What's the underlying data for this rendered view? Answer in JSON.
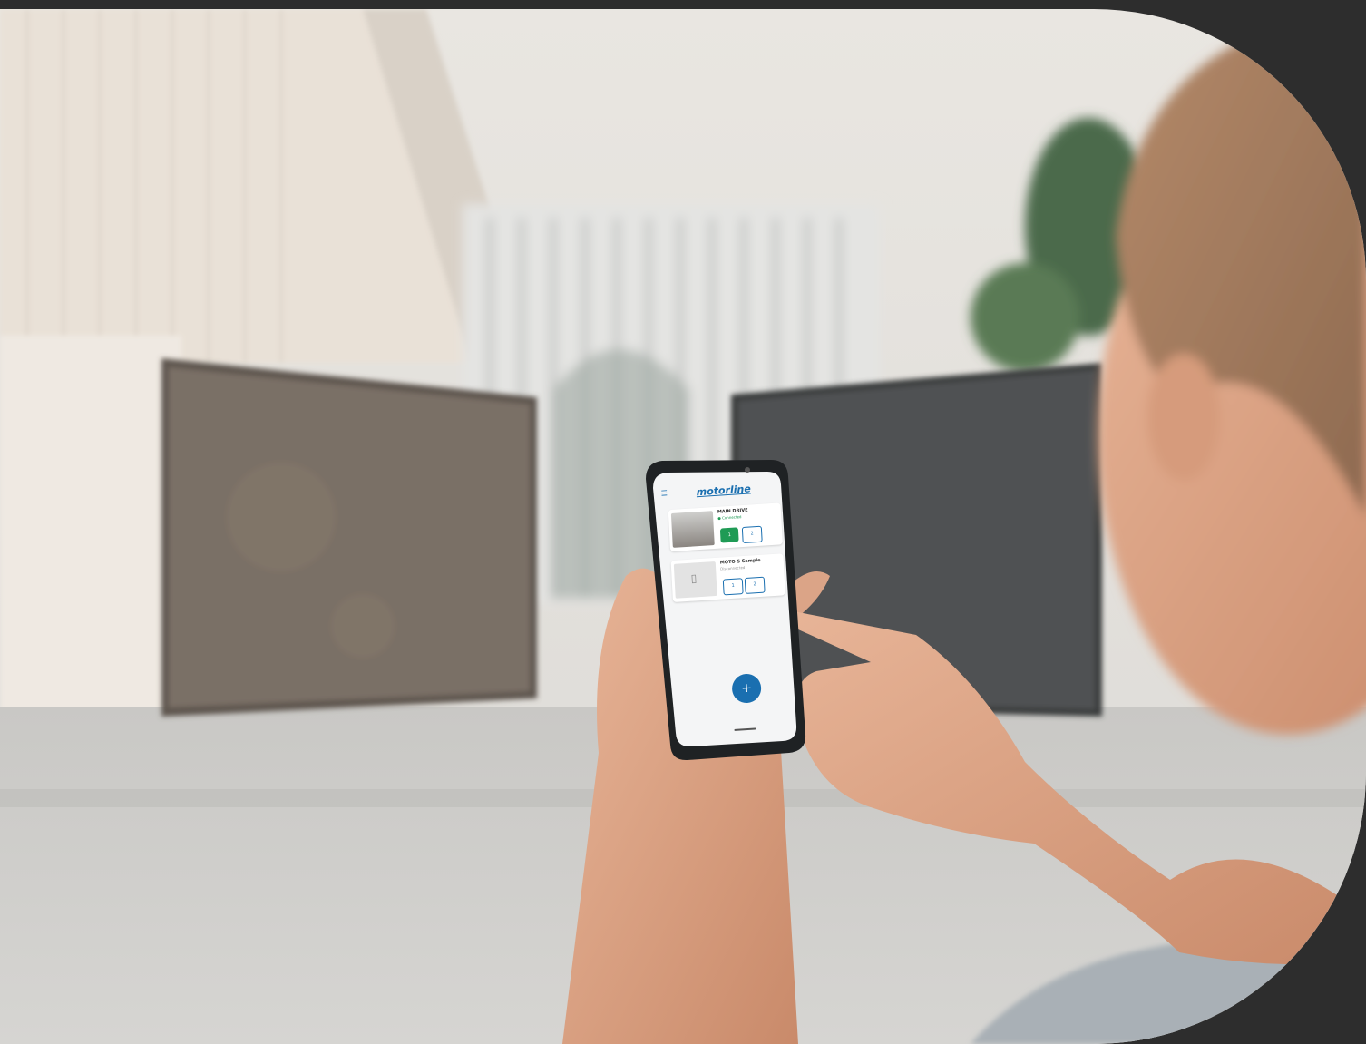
{
  "scene": {
    "colors": {
      "frame": "#2d2d2d",
      "sky": "#e6e3de",
      "wall": "#ece5dc",
      "gate_left": "#6e655c",
      "gate_right": "#4a4b4c",
      "ground": "#cfcfcd",
      "brand": "#1a6fb0",
      "accent_green": "#1f9b55"
    }
  },
  "phone": {
    "brand_logo": "motorline",
    "devices": [
      {
        "name": "MAIN DRIVE",
        "status": "● Connected",
        "buttons": [
          "1",
          "2"
        ]
      },
      {
        "name": "MOTO S Sample",
        "status": "Disconnected",
        "buttons": [
          "1",
          "2"
        ]
      }
    ],
    "fab_label": "+",
    "menu_icon": "hamburger-menu-icon"
  }
}
